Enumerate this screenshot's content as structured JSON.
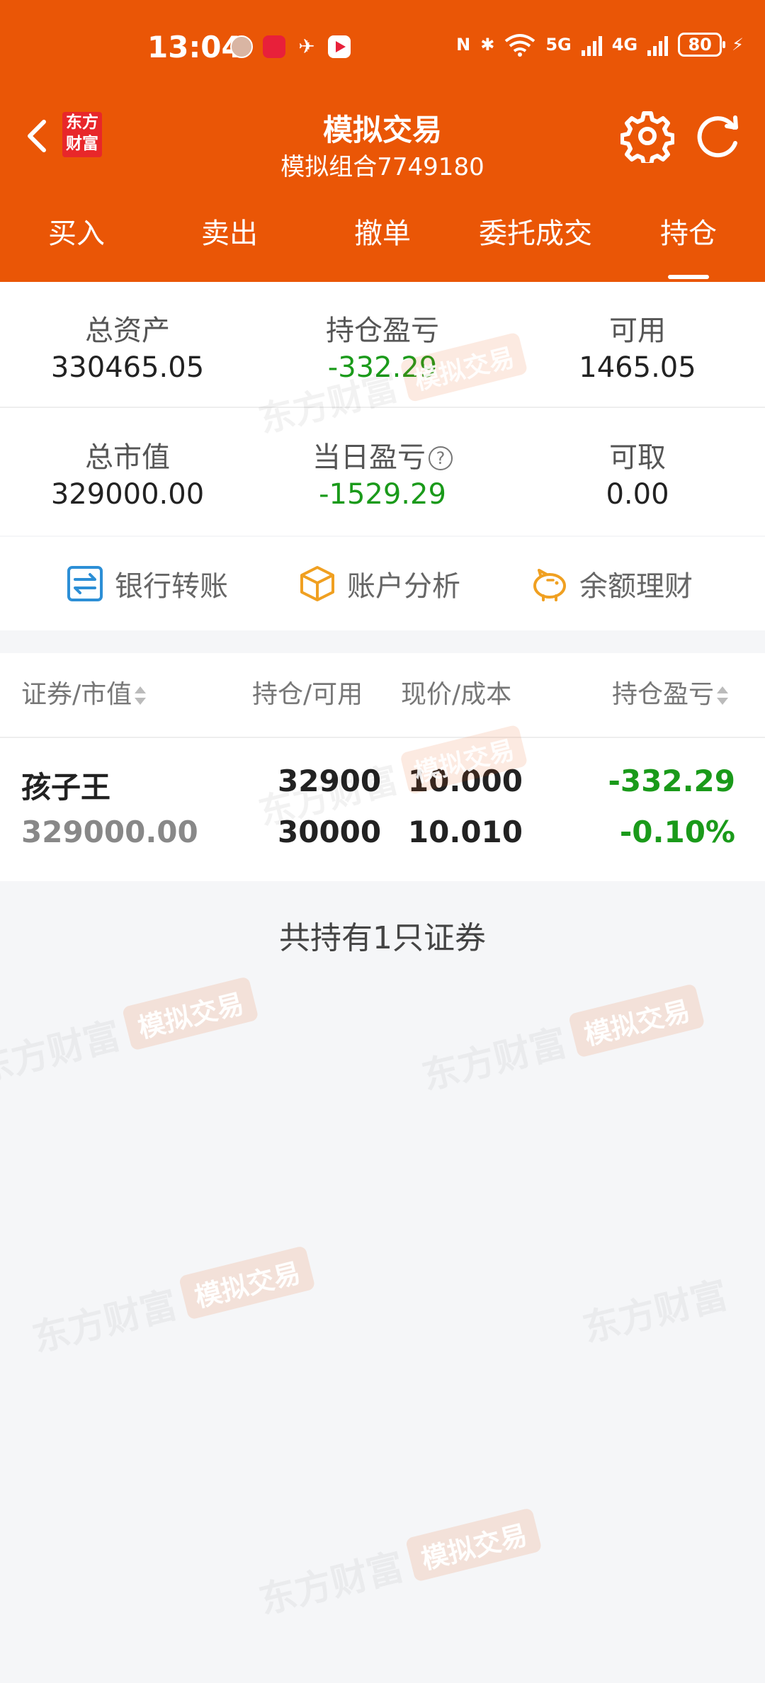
{
  "status_bar": {
    "time": "13:04",
    "network_5g": "5G",
    "network_4g": "4G",
    "battery": "80"
  },
  "nav": {
    "logo_line1": "东方",
    "logo_line2": "财富",
    "title": "模拟交易",
    "subtitle": "模拟组合7749180"
  },
  "tabs": [
    {
      "label": "买入",
      "active": false
    },
    {
      "label": "卖出",
      "active": false
    },
    {
      "label": "撤单",
      "active": false
    },
    {
      "label": "委托成交",
      "active": false
    },
    {
      "label": "持仓",
      "active": true
    }
  ],
  "summary": {
    "total_assets_label": "总资产",
    "total_assets": "330465.05",
    "position_pnl_label": "持仓盈亏",
    "position_pnl": "-332.29",
    "available_label": "可用",
    "available": "1465.05",
    "market_value_label": "总市值",
    "market_value": "329000.00",
    "daily_pnl_label": "当日盈亏",
    "daily_pnl": "-1529.29",
    "withdrawable_label": "可取",
    "withdrawable": "0.00"
  },
  "actions": {
    "bank_transfer": "银行转账",
    "account_analysis": "账户分析",
    "wealth": "余额理财"
  },
  "holdings": {
    "headers": {
      "security": "证券/市值",
      "position": "持仓/可用",
      "price": "现价/成本",
      "pnl": "持仓盈亏"
    },
    "rows": [
      {
        "name": "孩子王",
        "market_value": "329000.00",
        "position": "32900",
        "available": "30000",
        "price": "10.000",
        "cost": "10.010",
        "pnl": "-332.29",
        "pnl_pct": "-0.10%"
      }
    ],
    "footer": "共持有1只证券"
  },
  "watermark": {
    "brand": "东方财富",
    "tag": "模拟交易"
  },
  "colors": {
    "brand_orange": "#ea5606",
    "loss_green": "#1a9a1a"
  }
}
